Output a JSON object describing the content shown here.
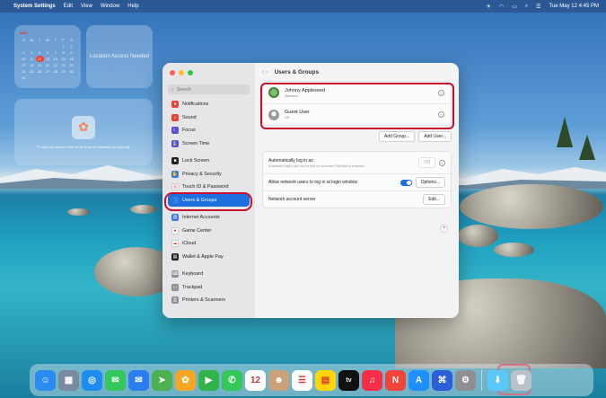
{
  "menubar": {
    "app_name": "System Settings",
    "menus": [
      "Edit",
      "View",
      "Window",
      "Help"
    ],
    "datetime": "Tue May 12  4:45 PM"
  },
  "widgets": {
    "calendar": {
      "month": "MAY",
      "weekdays": [
        "S",
        "M",
        "T",
        "W",
        "T",
        "F",
        "S"
      ],
      "weeks": [
        [
          "",
          "",
          "",
          "",
          "",
          "1",
          "2"
        ],
        [
          "3",
          "4",
          "5",
          "6",
          "7",
          "8",
          "9"
        ],
        [
          "10",
          "11",
          "12",
          "13",
          "14",
          "15",
          "16"
        ],
        [
          "17",
          "18",
          "19",
          "20",
          "21",
          "22",
          "23"
        ],
        [
          "24",
          "25",
          "26",
          "27",
          "28",
          "29",
          "30"
        ],
        [
          "31",
          "",
          "",
          "",
          "",
          "",
          ""
        ]
      ],
      "today": "12"
    },
    "location": "Location Access Needed",
    "photos_text": "Photos will appear here when they are finished processing."
  },
  "settings": {
    "search_placeholder": "Search",
    "sidebar": [
      {
        "label": "Notifications",
        "color": "#e8423a",
        "glyph": "●"
      },
      {
        "label": "Sound",
        "color": "#e8423a",
        "glyph": "♪"
      },
      {
        "label": "Focus",
        "color": "#5b4fd6",
        "glyph": "☾"
      },
      {
        "label": "Screen Time",
        "color": "#5b4fd6",
        "glyph": "⌛"
      },
      {
        "label": "Lock Screen",
        "color": "#222222",
        "glyph": "■"
      },
      {
        "label": "Privacy & Security",
        "color": "#3a7bd5",
        "glyph": "✋"
      },
      {
        "label": "Touch ID & Password",
        "color": "#ffffff",
        "glyph": "◎"
      },
      {
        "label": "Users & Groups",
        "color": "#3a7bd5",
        "glyph": "👥"
      },
      {
        "label": "Internet Accounts",
        "color": "#3a7bd5",
        "glyph": "@"
      },
      {
        "label": "Game Center",
        "color": "#ffffff",
        "glyph": "●"
      },
      {
        "label": "iCloud",
        "color": "#ffffff",
        "glyph": "☁"
      },
      {
        "label": "Wallet & Apple Pay",
        "color": "#222222",
        "glyph": "▤"
      },
      {
        "label": "Keyboard",
        "color": "#8e8e93",
        "glyph": "⌨"
      },
      {
        "label": "Trackpad",
        "color": "#8e8e93",
        "glyph": "▭"
      },
      {
        "label": "Printers & Scanners",
        "color": "#8e8e93",
        "glyph": "⎙"
      }
    ],
    "active_item": "Users & Groups",
    "page_title": "Users & Groups",
    "users": [
      {
        "name": "Johnny Appleseed",
        "role": "Standard"
      },
      {
        "name": "Guest User",
        "role": "Off"
      }
    ],
    "buttons": {
      "add_group": "Add Group...",
      "add_user": "Add User..."
    },
    "options": {
      "auto_login_label": "Automatically log in as",
      "auto_login_sub": "Automatic login can't be turned on because FileVault is enabled.",
      "auto_login_value": "Off",
      "network_users_label": "Allow network users to log in at login window",
      "options_button": "Options...",
      "network_server_label": "Network account server",
      "edit_button": "Edit..."
    },
    "help": "?"
  },
  "dock": [
    {
      "name": "finder",
      "color": "#2a8cf0",
      "glyph": "☺"
    },
    {
      "name": "launchpad",
      "color": "#7a8aa0",
      "glyph": "▦"
    },
    {
      "name": "safari",
      "color": "#1d8cf0",
      "glyph": "◎"
    },
    {
      "name": "messages",
      "color": "#34c759",
      "glyph": "✉"
    },
    {
      "name": "mail",
      "color": "#2a7ef0",
      "glyph": "✉"
    },
    {
      "name": "maps",
      "color": "#4caf50",
      "glyph": "➤"
    },
    {
      "name": "photos",
      "color": "#f5a623",
      "glyph": "✿"
    },
    {
      "name": "facetime",
      "color": "#2fb34a",
      "glyph": "▶"
    },
    {
      "name": "phone",
      "color": "#34c759",
      "glyph": "✆"
    },
    {
      "name": "calendar",
      "color": "#ffffff",
      "glyph": "12"
    },
    {
      "name": "contacts",
      "color": "#c9a27a",
      "glyph": "☻"
    },
    {
      "name": "reminders",
      "color": "#ffffff",
      "glyph": "☰"
    },
    {
      "name": "notes",
      "color": "#ffd60a",
      "glyph": "▤"
    },
    {
      "name": "tv",
      "color": "#111111",
      "glyph": "tv"
    },
    {
      "name": "music",
      "color": "#fa2d48",
      "glyph": "♫"
    },
    {
      "name": "news",
      "color": "#f0443a",
      "glyph": "N"
    },
    {
      "name": "app-store",
      "color": "#1e90ff",
      "glyph": "A"
    },
    {
      "name": "xcode",
      "color": "#2b5fd9",
      "glyph": "⌘"
    },
    {
      "name": "system-settings",
      "color": "#8e8e93",
      "glyph": "⚙"
    },
    {
      "name": "downloads",
      "color": "#5ac8fa",
      "glyph": "⬇"
    },
    {
      "name": "trash",
      "color": "#b9c2cb",
      "glyph": "🗑"
    }
  ]
}
